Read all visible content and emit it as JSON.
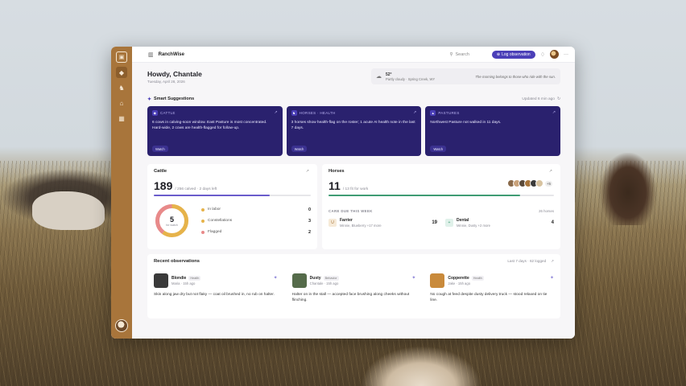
{
  "app": {
    "name": "RanchWise"
  },
  "topbar": {
    "search_placeholder": "Search",
    "log_button": "Log observation"
  },
  "greeting": {
    "title": "Howdy, Chantale",
    "date": "Tuesday, April 28, 2026"
  },
  "weather": {
    "temp": "52°",
    "desc": "Partly cloudy · Spring Creek, WY",
    "quote": "The morning belongs to those who ride with the sun."
  },
  "suggestions": {
    "title": "Smart Suggestions",
    "updated": "Updated 6 min ago",
    "cards": [
      {
        "tag": "CATTLE",
        "text": "6 cows in calving-soon window. East Pasture is most concentrated. Hard-wide, 2 cows are health-flagged for follow-up.",
        "button": "Watch"
      },
      {
        "tag": "HORSES · HEALTH",
        "text": "3 horses show health-flag on the roster; 1 acute AI health note in the last 7 days.",
        "button": "Watch"
      },
      {
        "tag": "PASTURES",
        "text": "Northwest Pasture not walked in 11 days.",
        "button": "Watch"
      }
    ]
  },
  "cattle": {
    "title": "Cattle",
    "big": "189",
    "sub": "/ 256 calved · 2 days left",
    "progress": 0.74,
    "donut_value": "5",
    "donut_label": "for watch",
    "legend": [
      {
        "label": "In labor",
        "value": "0",
        "color": "#e6b34a"
      },
      {
        "label": "Constellations",
        "value": "3",
        "color": "#e6b34a"
      },
      {
        "label": "Flagged",
        "value": "2",
        "color": "#e88a8a"
      }
    ]
  },
  "horses": {
    "title": "Horses",
    "big": "11",
    "sub": "/ 13 fit for work",
    "progress": 0.85,
    "more_count": "+5",
    "care_title": "CARE DUE THIS WEEK",
    "care_count": "26 horses",
    "care": [
      {
        "icon": "U",
        "name": "Farrier",
        "who": "Minnie, Blueberry +17 more",
        "value": "19",
        "bg": "#f6ead8",
        "fg": "#a8753b"
      },
      {
        "icon": "+",
        "name": "Dental",
        "who": "Minnie, Dusty +2 more",
        "value": "4",
        "bg": "#e0f1ea",
        "fg": "#3f9c74"
      }
    ]
  },
  "observations": {
    "title": "Recent observations",
    "meta": "Last 7 days · 62 logged",
    "items": [
      {
        "name": "Blondie",
        "tag": "Health",
        "who": "Maria · 15h ago",
        "text": "Skin along jaw dry but not flaky — coat oil brushed in, no rub on halter.",
        "avatar": "#3a3a3a"
      },
      {
        "name": "Dusty",
        "tag": "Behavior",
        "who": "Chantale · 15h ago",
        "text": "Halter on in the stall — accepted face brushing along cheeks without flinching.",
        "avatar": "#556b4a"
      },
      {
        "name": "Copperette",
        "tag": "Health",
        "who": "Jake · 15h ago",
        "text": "No cough at feed despite dusty delivery truck — stood relaxed on tie line.",
        "avatar": "#c98a3b"
      }
    ]
  }
}
